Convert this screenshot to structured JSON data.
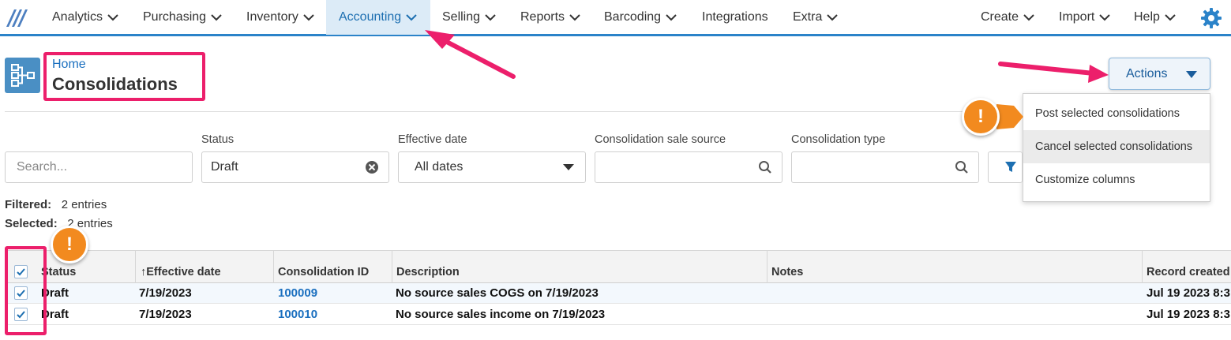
{
  "nav": {
    "items": [
      {
        "label": "Analytics"
      },
      {
        "label": "Purchasing"
      },
      {
        "label": "Inventory"
      },
      {
        "label": "Accounting"
      },
      {
        "label": "Selling"
      },
      {
        "label": "Reports"
      },
      {
        "label": "Barcoding"
      },
      {
        "label": "Integrations"
      },
      {
        "label": "Extra"
      }
    ],
    "right_items": [
      {
        "label": "Create"
      },
      {
        "label": "Import"
      },
      {
        "label": "Help"
      }
    ],
    "active": "Accounting"
  },
  "header": {
    "breadcrumb": "Home",
    "title": "Consolidations",
    "actions_label": "Actions"
  },
  "actions_menu": {
    "items": [
      {
        "label": "Post selected consolidations"
      },
      {
        "label": "Cancel selected consolidations"
      },
      {
        "label": "Customize columns"
      }
    ],
    "hovered": "Cancel selected consolidations"
  },
  "filters": {
    "search_placeholder": "Search...",
    "status_label": "Status",
    "status_value": "Draft",
    "effective_date_label": "Effective date",
    "effective_date_value": "All dates",
    "sale_source_label": "Consolidation sale source",
    "type_label": "Consolidation type"
  },
  "summary": {
    "filtered_label": "Filtered:",
    "filtered_value": "2 entries",
    "selected_label": "Selected:",
    "selected_value": "2 entries"
  },
  "table": {
    "columns": [
      "Status",
      "Effective date",
      "Consolidation ID",
      "Description",
      "Notes",
      "Record created"
    ],
    "sort_indicator": "↑",
    "rows": [
      {
        "status": "Draft",
        "effective_date": "7/19/2023",
        "id": "100009",
        "description": "No source sales COGS on 7/19/2023",
        "notes": "",
        "record_created": "Jul 19 2023 8:3"
      },
      {
        "status": "Draft",
        "effective_date": "7/19/2023",
        "id": "100010",
        "description": "No source sales income on 7/19/2023",
        "notes": "",
        "record_created": "Jul 19 2023 8:3"
      }
    ]
  },
  "annotations": {
    "badge_symbol": "!",
    "highlight_color": "#ec1f6b",
    "badge_color": "#f28a1f"
  },
  "colors": {
    "accent": "#2b83c9",
    "link": "#1a6fbf"
  }
}
